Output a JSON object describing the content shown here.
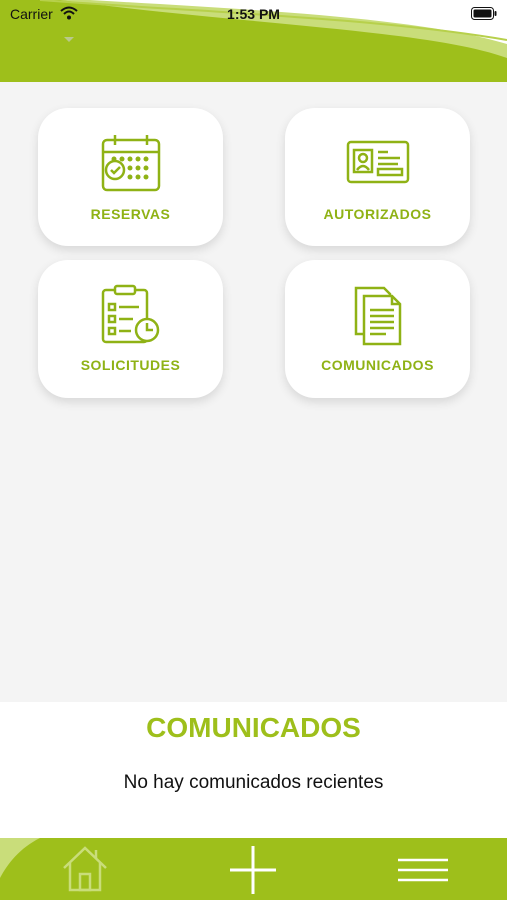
{
  "status_bar": {
    "carrier": "Carrier",
    "time": "1:53 PM"
  },
  "tiles": [
    {
      "label": "RESERVAS",
      "icon": "calendar-check-icon"
    },
    {
      "label": "AUTORIZADOS",
      "icon": "id-card-icon"
    },
    {
      "label": "SOLICITUDES",
      "icon": "clipboard-clock-icon"
    },
    {
      "label": "COMUNICADOS",
      "icon": "documents-icon"
    }
  ],
  "comunicados": {
    "title": "COMUNICADOS",
    "empty_message": "No hay comunicados recientes"
  },
  "bottom_nav": [
    {
      "icon": "home-icon"
    },
    {
      "icon": "plus-icon"
    },
    {
      "icon": "menu-icon"
    }
  ],
  "colors": {
    "accent": "#9ebf1b",
    "label": "#8fb215",
    "background": "#f4f4f4"
  }
}
